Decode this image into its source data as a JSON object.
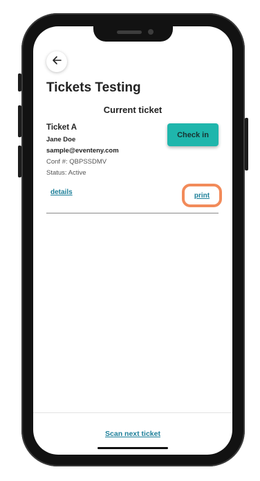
{
  "header": {
    "back_icon": "arrow-left-icon",
    "title": "Tickets Testing"
  },
  "ticket": {
    "section_title": "Current ticket",
    "name": "Ticket A",
    "holder": "Jane Doe",
    "email": "sample@eventeny.com",
    "conf": "Conf #: QBPSSDMV",
    "status": "Status: Active",
    "checkin_label": "Check in",
    "details_label": "details",
    "print_label": "print"
  },
  "footer": {
    "scan_label": "Scan next ticket"
  },
  "colors": {
    "accent": "#1fb6ac",
    "link": "#1d7f99",
    "highlight": "#f28b5a"
  }
}
